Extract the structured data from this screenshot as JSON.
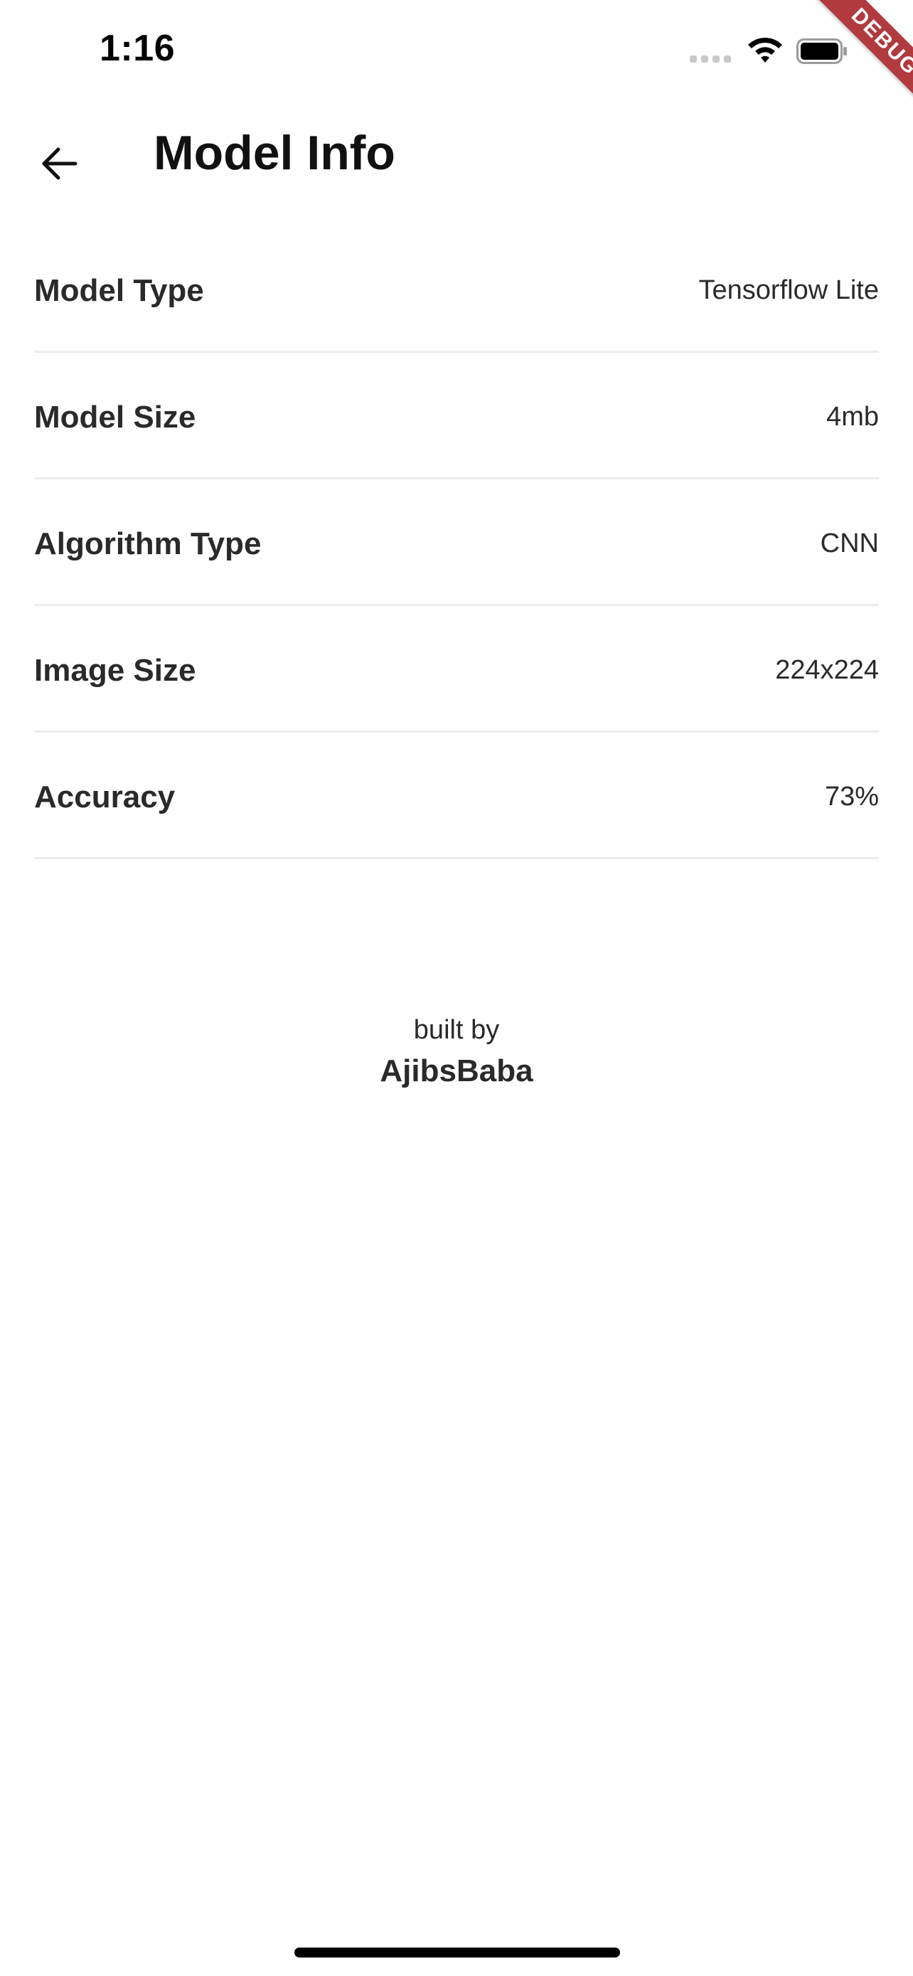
{
  "status_bar": {
    "time": "1:16",
    "icons": [
      "signal-icon",
      "wifi-icon",
      "battery-icon"
    ]
  },
  "debug_banner": {
    "label": "DEBUG",
    "color": "#b03a3e"
  },
  "app_bar": {
    "title": "Model Info",
    "back_icon": "arrow-left-icon"
  },
  "info_rows": [
    {
      "label": "Model Type",
      "value": "Tensorflow Lite"
    },
    {
      "label": "Model Size",
      "value": "4mb"
    },
    {
      "label": "Algorithm Type",
      "value": "CNN"
    },
    {
      "label": "Image Size",
      "value": "224x224"
    },
    {
      "label": "Accuracy",
      "value": "73%"
    }
  ],
  "credit": {
    "prefix": "built by",
    "author": "AjibsBaba"
  },
  "colors": {
    "background": "#ffffff",
    "text": "#2a2a2a",
    "divider": "#ececec"
  }
}
